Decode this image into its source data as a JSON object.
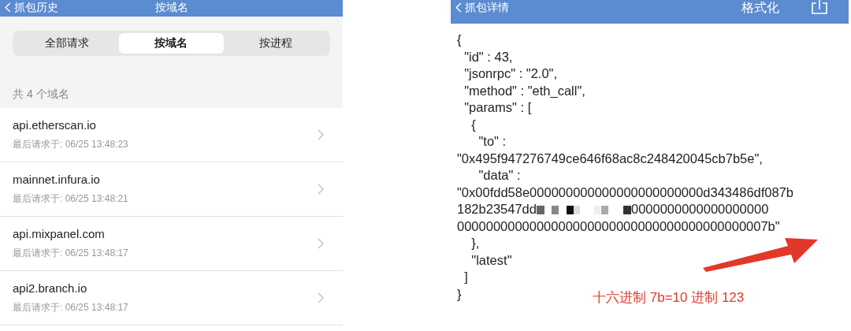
{
  "history_screen": {
    "nav": {
      "back_label": "抓包历史",
      "title": "按域名"
    },
    "segments": [
      {
        "label": "全部请求",
        "selected": false
      },
      {
        "label": "按域名",
        "selected": true
      },
      {
        "label": "按进程",
        "selected": false
      }
    ],
    "count_label": "共 4 个域名",
    "domains": [
      {
        "host": "api.etherscan.io",
        "last_request": "最后请求于: 06/25 13:48:23"
      },
      {
        "host": "mainnet.infura.io",
        "last_request": "最后请求于: 06/25 13:48:21"
      },
      {
        "host": "api.mixpanel.com",
        "last_request": "最后请求于: 06/25 13:48:17"
      },
      {
        "host": "api2.branch.io",
        "last_request": "最后请求于: 06/25 13:48:17"
      }
    ]
  },
  "detail_screen": {
    "nav": {
      "back_label": "抓包详情",
      "action": "格式化"
    },
    "code_lines": [
      {
        "kind": "text",
        "text": "{"
      },
      {
        "kind": "text",
        "text": "  \"id\" : 43,"
      },
      {
        "kind": "text",
        "text": "  \"jsonrpc\" : \"2.0\","
      },
      {
        "kind": "text",
        "text": "  \"method\" : \"eth_call\","
      },
      {
        "kind": "text",
        "text": "  \"params\" : ["
      },
      {
        "kind": "text",
        "text": "    {"
      },
      {
        "kind": "text",
        "text": "      \"to\" :"
      },
      {
        "kind": "text",
        "text": "\"0x495f947276749ce646f68ac8c248420045cb7b5e\","
      },
      {
        "kind": "text",
        "text": "      \"data\" :"
      },
      {
        "kind": "text",
        "text": "\"0x00fdd58e000000000000000000000000d343486df087b"
      },
      {
        "kind": "redacted",
        "prefix": "182b23547dd",
        "suffix": "0000000000000000000"
      },
      {
        "kind": "text",
        "text": "0000000000000000000000000000000000000000007b\""
      },
      {
        "kind": "text",
        "text": "    },"
      },
      {
        "kind": "text",
        "text": "    \"latest\""
      },
      {
        "kind": "text",
        "text": "  ]"
      },
      {
        "kind": "text",
        "text": "}"
      }
    ],
    "annotation": "十六进制 7b=10 进制 123"
  }
}
